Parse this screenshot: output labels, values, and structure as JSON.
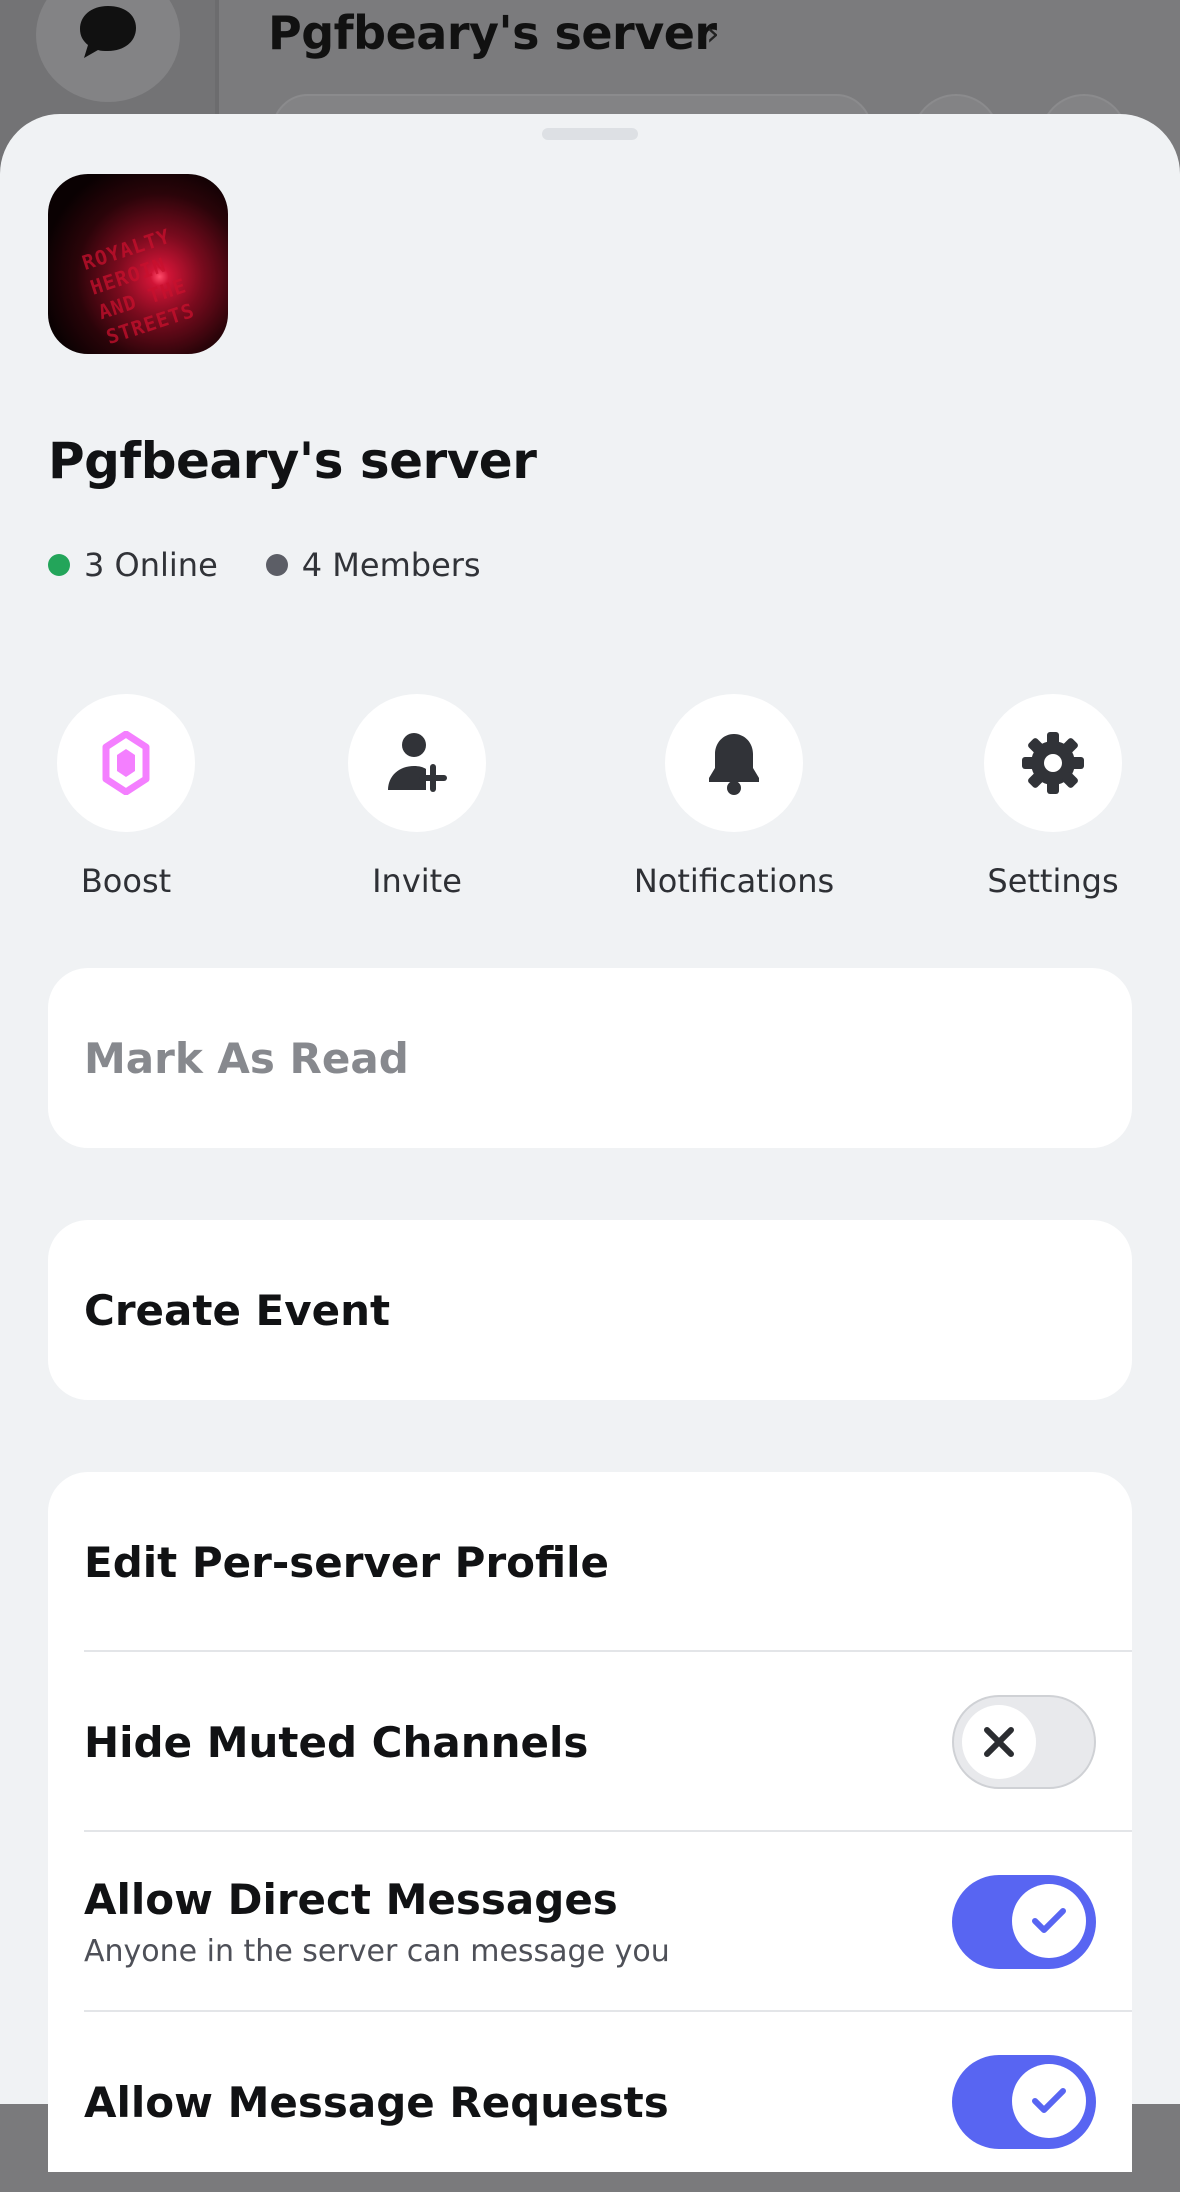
{
  "background": {
    "title": "Pgfbeary's server",
    "chevron": "›",
    "chat_icon": "chat-bubble-icon"
  },
  "sheet": {
    "server_name": "Pgfbeary's server",
    "server_icon_text": "ROYALTY HEROIN AND THE STREETS",
    "online": "3 Online",
    "members": "4 Members",
    "actions": [
      {
        "label": "Boost",
        "icon": "boost-gem-icon",
        "color": "#f47fff"
      },
      {
        "label": "Invite",
        "icon": "add-person-icon",
        "color": "#313338"
      },
      {
        "label": "Notifications",
        "icon": "bell-icon",
        "color": "#313338"
      },
      {
        "label": "Settings",
        "icon": "gear-icon",
        "color": "#313338"
      }
    ],
    "mark_as_read": "Mark As Read",
    "create_event": "Create Event",
    "settings_rows": {
      "edit_profile": "Edit Per-server Profile",
      "hide_muted": {
        "label": "Hide Muted Channels",
        "enabled": false
      },
      "allow_dms": {
        "label": "Allow Direct Messages",
        "sub": "Anyone in the server can message you",
        "enabled": true
      },
      "allow_requests": {
        "label": "Allow Message Requests",
        "enabled": true
      }
    }
  },
  "colors": {
    "accent": "#5865f2",
    "online": "#23a55a",
    "boost": "#f47fff"
  }
}
